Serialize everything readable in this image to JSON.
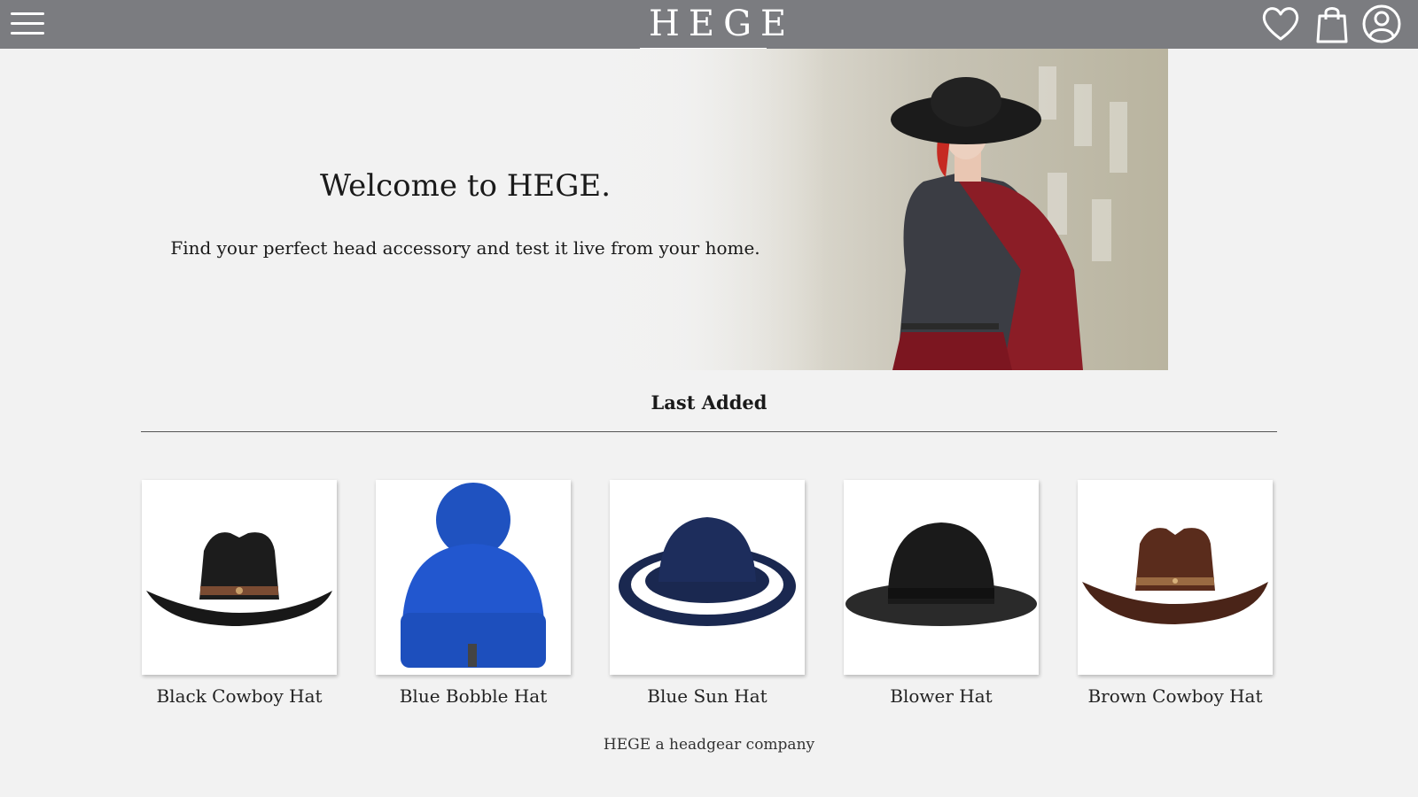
{
  "header": {
    "logo": "HEGE",
    "menu_icon": "hamburger-menu-icon",
    "wishlist_icon": "heart-icon",
    "cart_icon": "shopping-bag-icon",
    "account_icon": "user-account-icon",
    "bar_color": "#7b7c80"
  },
  "hero": {
    "title": "Welcome to HEGE.",
    "subtitle": "Find your perfect head accessory and test it live from your home."
  },
  "last_added": {
    "title": "Last Added",
    "products": [
      {
        "name": "Black Cowboy Hat"
      },
      {
        "name": "Blue Bobble Hat"
      },
      {
        "name": "Blue Sun Hat"
      },
      {
        "name": "Blower Hat"
      },
      {
        "name": "Brown Cowboy Hat"
      }
    ]
  },
  "footer": {
    "text": "HEGE a headgear company"
  }
}
